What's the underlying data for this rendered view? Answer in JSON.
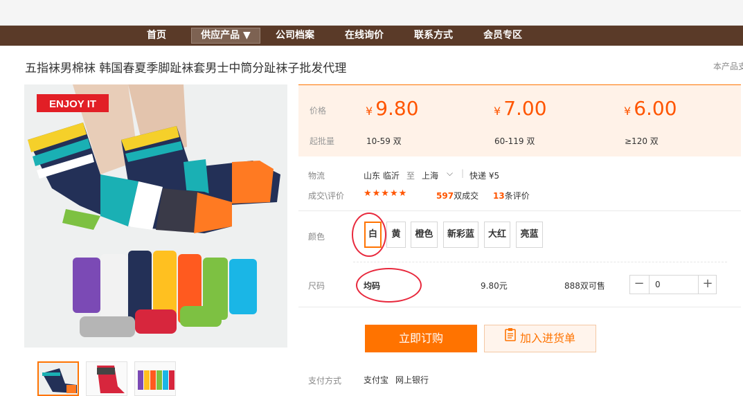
{
  "nav": {
    "items": [
      {
        "label": "首页"
      },
      {
        "label": "供应产品 ▼"
      },
      {
        "label": "公司档案"
      },
      {
        "label": "在线询价"
      },
      {
        "label": "联系方式"
      },
      {
        "label": "会员专区"
      }
    ]
  },
  "product": {
    "title": "五指袜男棉袜 韩国春夏季脚趾袜套男士中筒分趾袜子批发代理",
    "corner_text": "本产品支",
    "image_badge": "ENJOY IT"
  },
  "price": {
    "price_label": "价格",
    "moq_label": "起批量",
    "currency": "¥",
    "tiers": [
      {
        "price": "9.80",
        "qty": "10-59 双"
      },
      {
        "price": "7.00",
        "qty": "60-119 双"
      },
      {
        "price": "6.00",
        "qty": "≥120 双"
      }
    ]
  },
  "logistics": {
    "label": "物流",
    "from": "山东 临沂",
    "to_word": "至",
    "to": "上海",
    "method": "快递 ¥5"
  },
  "deals": {
    "label": "成交\\评价",
    "stars": "★★★★★",
    "deals_count": "597",
    "deals_text": "双成交",
    "reviews_count": "13",
    "reviews_text": "条评价"
  },
  "colors": {
    "label": "颜色",
    "options": [
      "白",
      "黄",
      "橙色",
      "新彩蓝",
      "大红",
      "亮蓝"
    ],
    "selected_index": 0
  },
  "size": {
    "label": "尺码",
    "value": "均码",
    "unit_price": "9.80元",
    "stock": "888双可售",
    "quantity": "0",
    "minus": "−",
    "plus": "+"
  },
  "actions": {
    "order_label": "立即订购",
    "cart_label": "加入进货单"
  },
  "payment": {
    "label": "支付方式",
    "methods": [
      "支付宝",
      "网上银行"
    ]
  },
  "colors_theme": {
    "accent": "#ff7300",
    "price": "#ff5500",
    "nav_bg": "#5a3a28",
    "annotation": "#e8283c"
  }
}
